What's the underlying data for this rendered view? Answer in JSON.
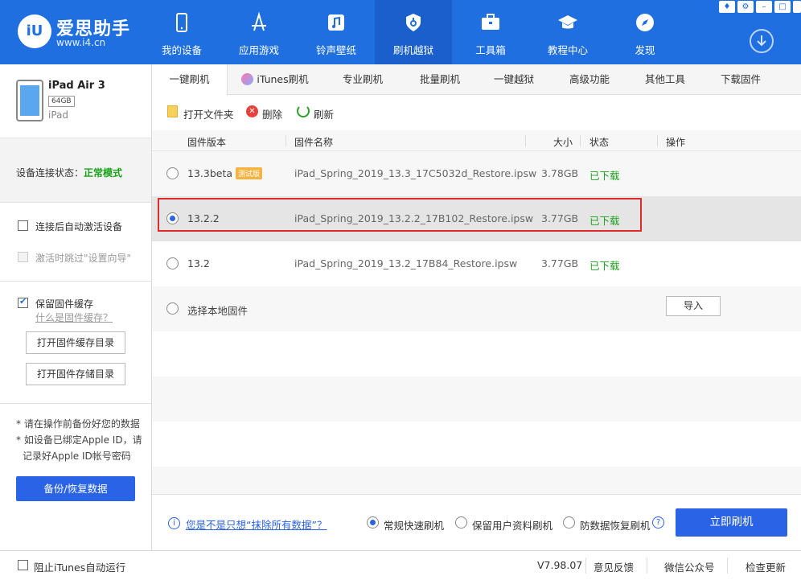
{
  "app": {
    "logo_mark": "iU",
    "logo_name": "爱思助手",
    "logo_url": "www.i4.cn"
  },
  "nav": [
    {
      "label": "我的设备",
      "icon": "phone-icon"
    },
    {
      "label": "应用游戏",
      "icon": "apps-icon"
    },
    {
      "label": "铃声壁纸",
      "icon": "music-icon"
    },
    {
      "label": "刷机越狱",
      "icon": "flash-icon",
      "active": true
    },
    {
      "label": "工具箱",
      "icon": "toolbox-icon"
    },
    {
      "label": "教程中心",
      "icon": "graduation-cap-icon"
    },
    {
      "label": "发现",
      "icon": "compass-icon"
    }
  ],
  "device": {
    "name": "iPad Air 3",
    "capacity": "64GB",
    "type": "iPad"
  },
  "connection": {
    "label": "设备连接状态：",
    "value": "正常模式"
  },
  "options": {
    "auto_activate": "连接后自动激活设备",
    "skip_setup": "激活时跳过\"设置向导\""
  },
  "cache": {
    "keep_label": "保留固件缓存",
    "what_link": "什么是固件缓存？",
    "open_cache_btn": "打开固件缓存目录",
    "open_storage_btn": "打开固件存储目录"
  },
  "notes": {
    "line1": "* 请在操作前备份好您的数据",
    "line2": "* 如设备已绑定Apple ID，请",
    "line3": "记录好Apple ID帐号密码",
    "backup_btn": "备份/恢复数据"
  },
  "tabs": [
    "一键刷机",
    "iTunes刷机",
    "专业刷机",
    "批量刷机",
    "一键越狱",
    "高级功能",
    "其他工具",
    "下载固件"
  ],
  "toolbar": {
    "open_folder": "打开文件夹",
    "delete": "删除",
    "refresh": "刷新"
  },
  "table": {
    "headers": {
      "version": "固件版本",
      "name": "固件名称",
      "size": "大小",
      "status": "状态",
      "action": "操作"
    },
    "rows": [
      {
        "version": "13.3beta",
        "badge": "测试版",
        "name": "iPad_Spring_2019_13.3_17C5032d_Restore.ipsw",
        "size": "3.78GB",
        "status": "已下载"
      },
      {
        "version": "13.2.2",
        "name": "iPad_Spring_2019_13.2.2_17B102_Restore.ipsw",
        "size": "3.77GB",
        "status": "已下载"
      },
      {
        "version": "13.2",
        "name": "iPad_Spring_2019_13.2_17B84_Restore.ipsw",
        "size": "3.77GB",
        "status": "已下载"
      }
    ],
    "local_label": "选择本地固件",
    "import_btn": "导入"
  },
  "bottom": {
    "question": "您是不是只想“抹除所有数据”？",
    "mode1": "常规快速刷机",
    "mode2": "保留用户资料刷机",
    "mode3": "防数据恢复刷机",
    "flash_btn": "立即刷机"
  },
  "statusbar": {
    "itunes_block": "阻止iTunes自动运行",
    "version": "V7.98.07",
    "feedback": "意见反馈",
    "wechat": "微信公众号",
    "update": "检查更新"
  },
  "colors": {
    "brand": "#1f6fe0",
    "accent": "#2a63e6",
    "ok_green": "#1aa31a",
    "highlight_red": "#e02b2b"
  }
}
